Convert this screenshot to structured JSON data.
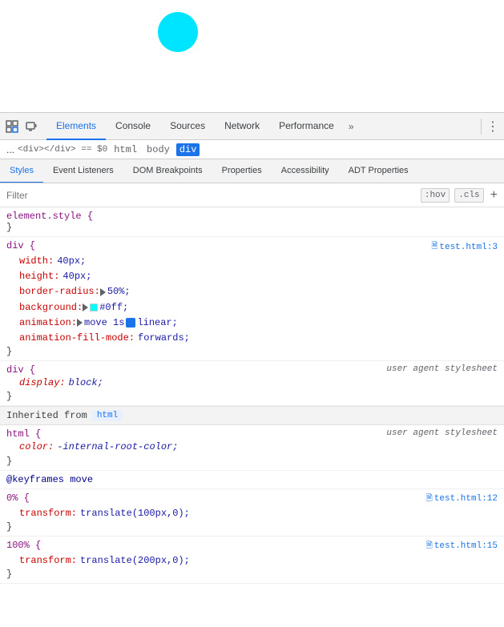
{
  "viewport": {
    "circle_color": "#00e5ff"
  },
  "toolbar": {
    "inspect_icon": "⬚",
    "device_icon": "⬜",
    "tabs": [
      {
        "label": "Elements",
        "active": true
      },
      {
        "label": "Console",
        "active": false
      },
      {
        "label": "Sources",
        "active": false
      },
      {
        "label": "Network",
        "active": false
      },
      {
        "label": "Performance",
        "active": false
      }
    ],
    "more_label": "»",
    "menu_label": "⋮"
  },
  "breadcrumb": {
    "ellipsis": "...",
    "items": [
      {
        "label": "html",
        "active": false
      },
      {
        "label": "body",
        "active": false
      },
      {
        "label": "div",
        "active": true
      }
    ],
    "selected_note": "<div></div> == $0"
  },
  "sub_tabs": [
    {
      "label": "Styles",
      "active": true
    },
    {
      "label": "Event Listeners",
      "active": false
    },
    {
      "label": "DOM Breakpoints",
      "active": false
    },
    {
      "label": "Properties",
      "active": false
    },
    {
      "label": "Accessibility",
      "active": false
    },
    {
      "label": "ADT Properties",
      "active": false
    }
  ],
  "filter": {
    "placeholder": "Filter",
    "hov_label": ":hov",
    "cls_label": ".cls",
    "plus_label": "+"
  },
  "styles": {
    "rules": [
      {
        "id": "element-style",
        "selector": "element.style {",
        "close": "}",
        "properties": [],
        "link": null,
        "user_agent": false
      },
      {
        "id": "div-main",
        "selector": "div {",
        "close": "}",
        "properties": [
          {
            "name": "width:",
            "value": "40px;",
            "type": "normal"
          },
          {
            "name": "height:",
            "value": "40px;",
            "type": "normal"
          },
          {
            "name": "border-radius:",
            "value": "▶ 50%;",
            "type": "triangle"
          },
          {
            "name": "background:",
            "value": "#0ff;",
            "type": "color",
            "color": "#00ffff"
          },
          {
            "name": "animation:",
            "value": "▶ move 1s ☑ linear;",
            "type": "anim"
          },
          {
            "name": "animation-fill-mode:",
            "value": "forwards;",
            "type": "normal"
          }
        ],
        "link": "test.html:3",
        "user_agent": false
      },
      {
        "id": "div-useragent",
        "selector": "div {",
        "close": "}",
        "properties": [
          {
            "name": "display:",
            "value": "block;",
            "type": "normal"
          }
        ],
        "link": null,
        "user_agent": true,
        "ua_label": "user agent stylesheet"
      }
    ],
    "inherited_from": "html",
    "html_rule": {
      "selector": "html {",
      "close": "}",
      "properties": [
        {
          "name": "color:",
          "value": "-internal-root-color;",
          "type": "normal"
        }
      ],
      "user_agent": true,
      "ua_label": "user agent stylesheet"
    },
    "keyframes": {
      "name": "@keyframes move",
      "frames": [
        {
          "percent": "0%",
          "open": " {",
          "close": "}",
          "properties": [
            {
              "name": "transform:",
              "value": "translate(100px,0);"
            }
          ],
          "link": "test.html:12"
        },
        {
          "percent": "100%",
          "open": " {",
          "close": "}",
          "properties": [
            {
              "name": "transform:",
              "value": "translate(200px,0);"
            }
          ],
          "link": "test.html:15"
        }
      ]
    }
  }
}
